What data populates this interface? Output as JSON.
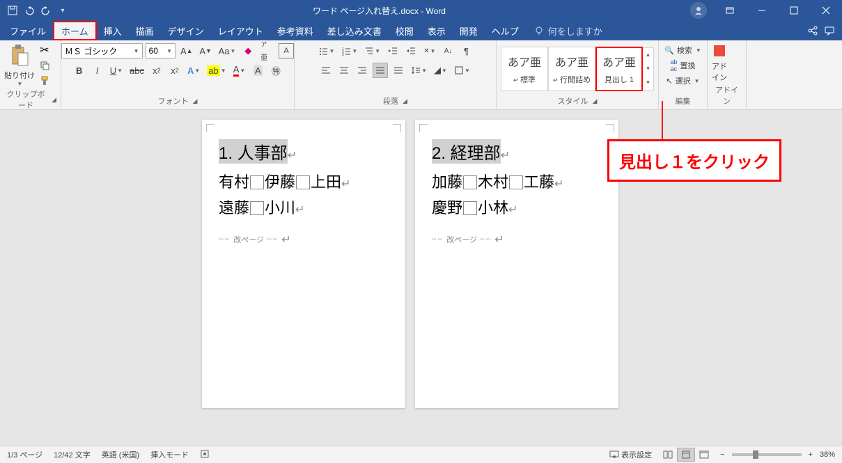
{
  "titlebar": {
    "doc_title": "ワード ページ入れ替え.docx  -  Word"
  },
  "menu": {
    "file": "ファイル",
    "home": "ホーム",
    "insert": "挿入",
    "draw": "描画",
    "design": "デザイン",
    "layout": "レイアウト",
    "references": "参考資料",
    "mailings": "差し込み文書",
    "review": "校閲",
    "view": "表示",
    "developer": "開発",
    "help": "ヘルプ",
    "tellme": "何をしますか"
  },
  "ribbon": {
    "clipboard": {
      "paste": "貼り付け",
      "label": "クリップボード"
    },
    "font": {
      "name": "ＭＳ ゴシック",
      "size": "60",
      "label": "フォント"
    },
    "paragraph": {
      "label": "段落"
    },
    "styles": {
      "preview": "あア亜",
      "normal": "標準",
      "nospace": "行間詰め",
      "heading1": "見出し 1",
      "label": "スタイル"
    },
    "editing": {
      "find": "検索",
      "replace": "置換",
      "select": "選択",
      "label": "編集"
    },
    "addin": {
      "label_top": "アド",
      "label_bottom": "イン",
      "group": "アドイン"
    }
  },
  "pages": [
    {
      "heading": "1. 人事部",
      "line1_a": "有村",
      "line1_b": "伊藤",
      "line1_c": "上田",
      "line2_a": "遠藤",
      "line2_b": "小川",
      "pagebreak": "改ページ"
    },
    {
      "heading": "2. 経理部",
      "line1_a": "加藤",
      "line1_b": "木村",
      "line1_c": "工藤",
      "line2_a": "慶野",
      "line2_b": "小林",
      "pagebreak": "改ページ"
    }
  ],
  "callout": "見出し１をクリック",
  "statusbar": {
    "page": "1/3 ページ",
    "words": "12/42 文字",
    "lang": "英語 (米国)",
    "mode": "挿入モード",
    "display": "表示設定",
    "zoom": "38%"
  }
}
